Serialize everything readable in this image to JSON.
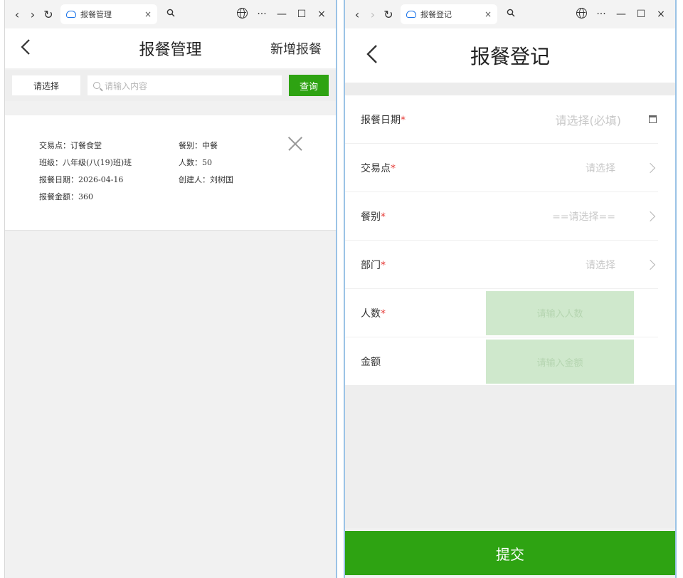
{
  "left": {
    "tab_title": "报餐管理",
    "header": {
      "title": "报餐管理",
      "action": "新增报餐"
    },
    "search": {
      "select_label": "请选择",
      "placeholder": "请输入内容",
      "query_label": "查询"
    },
    "record": {
      "trade_point": "交易点：订餐食堂",
      "meal_type": "餐别：中餐",
      "class": "班级：八年级(八(19)班)班",
      "count": "人数：50",
      "date": "报餐日期：2026-04-16",
      "creator": "创建人：刘树国",
      "amount": "报餐金额：360"
    }
  },
  "right": {
    "tab_title": "报餐登记",
    "header": {
      "title": "报餐登记"
    },
    "form": [
      {
        "label": "报餐日期",
        "required": "*",
        "placeholder": "请选择(必填)"
      },
      {
        "label": "交易点",
        "required": "*",
        "placeholder": "请选择"
      },
      {
        "label": "餐别",
        "required": "*",
        "placeholder": "==请选择=="
      },
      {
        "label": "部门",
        "required": "*",
        "placeholder": "请选择"
      },
      {
        "label": "人数",
        "required": "*",
        "placeholder": "请输入人数"
      },
      {
        "label": "金额",
        "required": "",
        "placeholder": "请输入金额"
      }
    ],
    "submit_label": "提交"
  },
  "chrome": {
    "back": "‹",
    "forward": "›",
    "reload": "↻",
    "close_tab": "×",
    "zoom": "🔍",
    "more": "···",
    "minimize": "—",
    "maximize": "☐",
    "close": "×"
  },
  "icons": {
    "back": "back-arrow-icon",
    "search": "search-icon",
    "close": "close-icon",
    "chevron": "chevron-right-icon",
    "calendar": "calendar-icon",
    "globe": "globe-icon"
  },
  "colors": {
    "accent": "#2ea312",
    "required": "#e53935",
    "input_bg": "#cfe8cc"
  }
}
